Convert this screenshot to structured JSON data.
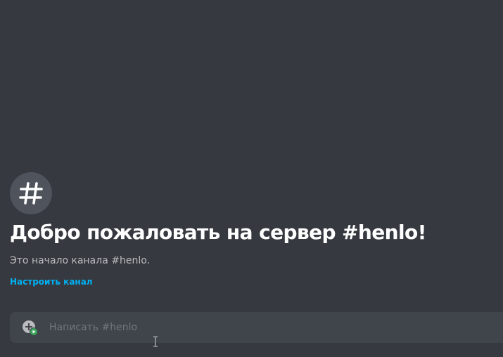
{
  "channel": {
    "icon": "hash-icon"
  },
  "welcome": {
    "title": "Добро пожаловать на сервер #henlo!",
    "subtitle": "Это начало канала #henlo.",
    "setup_link": "Настроить канал"
  },
  "composer": {
    "attach_icon": "add-attachment-icon",
    "placeholder": "Написать #henlo",
    "value": ""
  },
  "colors": {
    "background": "#36393f",
    "icon_circle": "#4f545c",
    "composer_bg": "#40444b",
    "link": "#00b0f4",
    "attach_badge": "#3ba55c"
  }
}
